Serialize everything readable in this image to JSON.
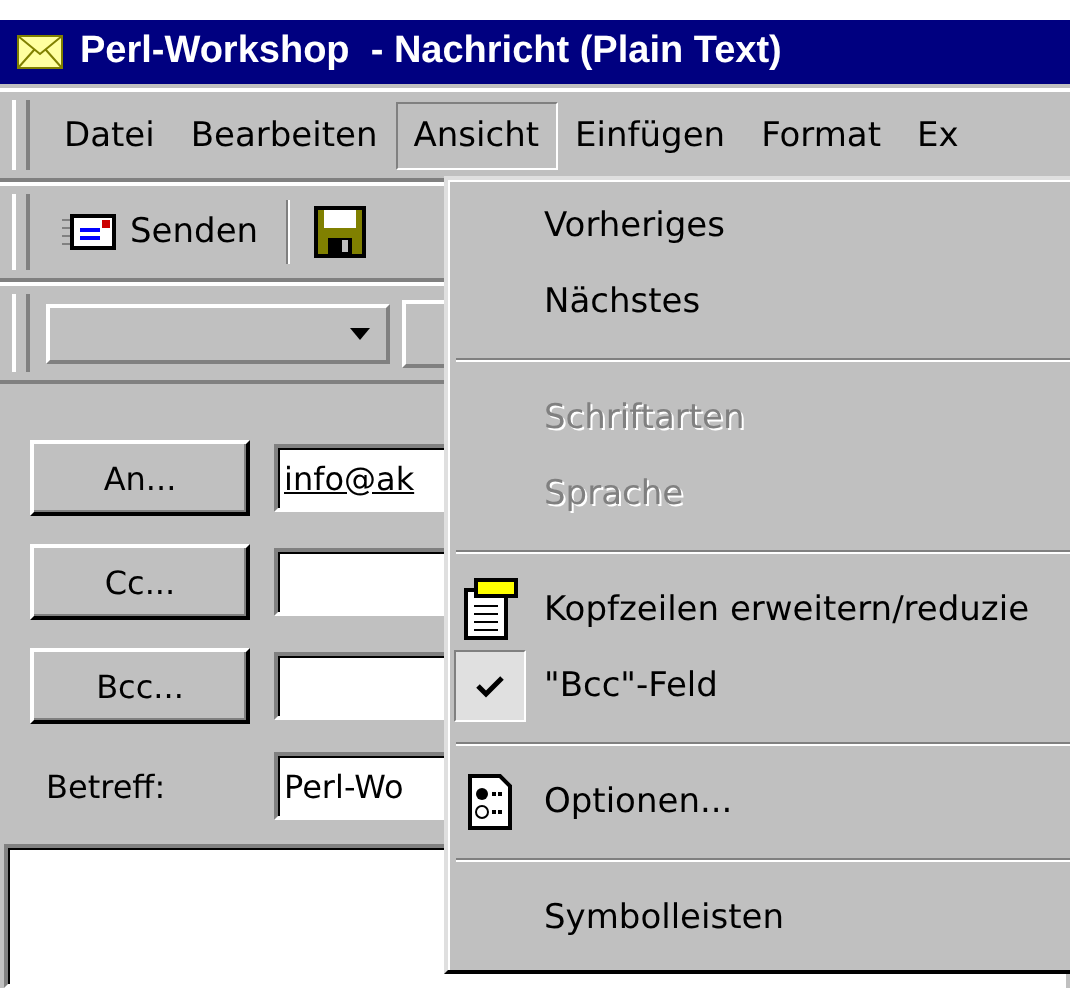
{
  "window": {
    "title": "Perl-Workshop  - Nachricht (Plain Text)"
  },
  "menu_bar": [
    {
      "label": "Datei",
      "selected": false
    },
    {
      "label": "Bearbeiten",
      "selected": false
    },
    {
      "label": "Ansicht",
      "selected": true
    },
    {
      "label": "Einfügen",
      "selected": false
    },
    {
      "label": "Format",
      "selected": false
    },
    {
      "label": "Ex",
      "selected": false
    }
  ],
  "toolbar": {
    "send_button": "Senden"
  },
  "form": {
    "recipients": [
      {
        "button": "An...",
        "value": "info@ak"
      },
      {
        "button": "Cc..."
      },
      {
        "button": "Bcc..."
      }
    ],
    "subject": {
      "label": "Betreff:",
      "value": "Perl-Wo"
    }
  },
  "view_menu": [
    {
      "kind": "plain",
      "label": "Vorheriges",
      "disabled": false
    },
    {
      "kind": "plain",
      "label": "Nächstes",
      "disabled": false
    },
    {
      "kind": "separator"
    },
    {
      "kind": "plain",
      "label": "Schriftarten",
      "disabled": true
    },
    {
      "kind": "plain",
      "label": "Sprache",
      "disabled": true
    },
    {
      "kind": "separator"
    },
    {
      "kind": "header-icon",
      "label": "Kopfzeilen erweitern/reduzie",
      "disabled": false
    },
    {
      "kind": "check",
      "label": "\"Bcc\"-Feld",
      "disabled": false,
      "checked": true
    },
    {
      "kind": "separator"
    },
    {
      "kind": "options-icon",
      "label": "Optionen...",
      "disabled": false
    },
    {
      "kind": "separator"
    },
    {
      "kind": "plain",
      "label": "Symbolleisten",
      "disabled": false
    }
  ]
}
